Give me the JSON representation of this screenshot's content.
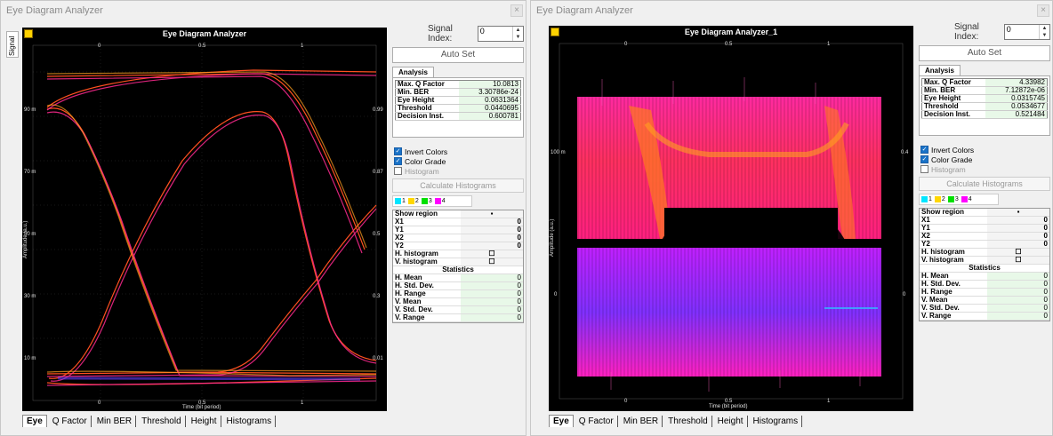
{
  "windows": [
    {
      "title": "Eye Diagram Analyzer",
      "close_glyph": "×",
      "side_tab": "Signal",
      "plot": {
        "title": "Eye Diagram Analyzer",
        "xlabel": "Time (bit period)",
        "ylabel": "Amplitude (a.u.)",
        "x_ticks": [
          "0",
          "0.5",
          "1"
        ],
        "y_ticks_left": [
          "90 m",
          "70 m",
          "50 m",
          "30 m",
          "10 m"
        ],
        "y_ticks_right": [
          "0.99",
          "0.87",
          "0.5",
          "0.3",
          "0.01"
        ]
      },
      "bottom_tabs": [
        "Eye",
        "Q Factor",
        "Min BER",
        "Threshold",
        "Height",
        "Histograms"
      ],
      "signal_index_label": "Signal Index:",
      "signal_index_value": "0",
      "autoset_label": "Auto Set",
      "analysis_tab": "Analysis",
      "analysis": [
        {
          "label": "Max. Q Factor",
          "value": "10.0813"
        },
        {
          "label": "Min. BER",
          "value": "3.30786e-24"
        },
        {
          "label": "Eye Height",
          "value": "0.0631364"
        },
        {
          "label": "Threshold",
          "value": "0.0440695"
        },
        {
          "label": "Decision Inst.",
          "value": "0.600781"
        }
      ],
      "invert_colors": "Invert Colors",
      "color_grade": "Color Grade",
      "histogram": "Histogram",
      "calc_histograms": "Calculate Histograms",
      "swatches": [
        "1",
        "2",
        "3",
        "4"
      ],
      "region_rows": [
        "Show region",
        "X1",
        "Y1",
        "X2",
        "Y2",
        "H. histogram",
        "V. histogram"
      ],
      "statistics_label": "Statistics",
      "stat_rows": [
        "H. Mean",
        "H. Std. Dev.",
        "H. Range",
        "V. Mean",
        "V. Std. Dev.",
        "V. Range"
      ],
      "zero": "0"
    },
    {
      "title": "Eye Diagram Analyzer",
      "close_glyph": "×",
      "side_tab": "",
      "plot": {
        "title": "Eye Diagram Analyzer_1",
        "xlabel": "Time (bit period)",
        "ylabel": "Amplitude (a.u.)",
        "x_ticks": [
          "0",
          "0.5",
          "1"
        ],
        "y_ticks_left": [
          "100 m",
          "0"
        ],
        "y_ticks_right": [
          "0.4",
          "0"
        ]
      },
      "bottom_tabs": [
        "Eye",
        "Q Factor",
        "Min BER",
        "Threshold",
        "Height",
        "Histograms"
      ],
      "signal_index_label": "Signal Index:",
      "signal_index_value": "0",
      "autoset_label": "Auto Set",
      "analysis_tab": "Analysis",
      "analysis": [
        {
          "label": "Max. Q Factor",
          "value": "4.33982"
        },
        {
          "label": "Min. BER",
          "value": "7.12872e-06"
        },
        {
          "label": "Eye Height",
          "value": "0.0315745"
        },
        {
          "label": "Threshold",
          "value": "0.0534677"
        },
        {
          "label": "Decision Inst.",
          "value": "0.521484"
        }
      ],
      "invert_colors": "Invert Colors",
      "color_grade": "Color Grade",
      "histogram": "Histogram",
      "calc_histograms": "Calculate Histograms",
      "swatches": [
        "1",
        "2",
        "3",
        "4"
      ],
      "region_rows": [
        "Show region",
        "X1",
        "Y1",
        "X2",
        "Y2",
        "H. histogram",
        "V. histogram"
      ],
      "statistics_label": "Statistics",
      "stat_rows": [
        "H. Mean",
        "H. Std. Dev.",
        "H. Range",
        "V. Mean",
        "V. Std. Dev.",
        "V. Range"
      ],
      "zero": "0"
    }
  ],
  "colors": {
    "swatch1": "#00e5ff",
    "swatch2": "#ffd700",
    "swatch3": "#00e000",
    "swatch4": "#ff00ff",
    "checkbox_on": "#1a73c8",
    "eye_trace": "#ff6030",
    "eye_trace_alt": "#ff2090"
  }
}
